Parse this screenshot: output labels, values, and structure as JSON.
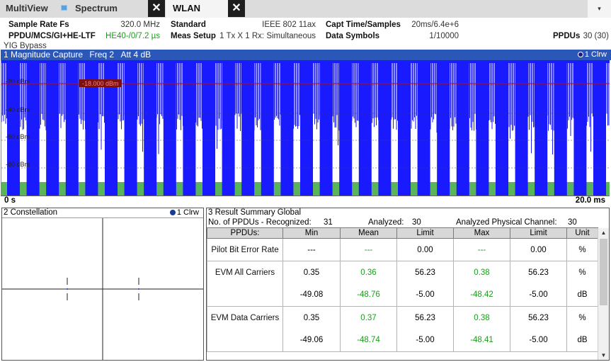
{
  "tabs": {
    "multiview": "MultiView",
    "spectrum": "Spectrum",
    "wlan": "WLAN",
    "close_glyph": "✕",
    "menu_glyph": "▾"
  },
  "header": {
    "sample_rate_label": "Sample Rate Fs",
    "sample_rate_value": "320.0 MHz",
    "standard_label": "Standard",
    "standard_value": "IEEE 802 11ax",
    "capt_label": "Capt Time/Samples",
    "capt_value": "20ms/6.4e+6",
    "ppdu_label": "PPDU/MCS/GI+HE-LTF",
    "ppdu_value": "HE40-/0/7.2 µs",
    "meas_label": "Meas Setup",
    "meas_value": "1 Tx X 1 Rx: Simultaneous",
    "data_symbols_label": "Data Symbols",
    "data_symbols_value": "1/10000",
    "ppdus_label": "PPDUs",
    "ppdus_value": "30 (30)",
    "yig": "YIG Bypass"
  },
  "magnitude": {
    "title": "1 Magnitude Capture",
    "freq": "Freq 2",
    "att": "Att 4 dB",
    "trace": "1 Clrw",
    "trigger_label": "-18.000 dBm",
    "x_start": "0 s",
    "x_end": "20.0 ms",
    "y_ticks": [
      "-20 dBm",
      "-40 dBm",
      "-60 dBm",
      "-80 dBm"
    ],
    "colors": {
      "signal": "#1a1aff",
      "gate": "#5ab45a",
      "trigger": "#cc0000",
      "title_bar": "#2b58b8"
    }
  },
  "constellation": {
    "title": "2 Constellation",
    "trace": "1 Clrw"
  },
  "results": {
    "title": "3 Result Summary Global",
    "recognized_label": "No. of PPDUs - Recognized:",
    "recognized_value": "31",
    "analyzed_label": "Analyzed:",
    "analyzed_value": "30",
    "analyzed_ch_label": "Analyzed Physical Channel:",
    "analyzed_ch_value": "30",
    "columns": [
      "PPDUs:",
      "Min",
      "Mean",
      "Limit",
      "Max",
      "Limit",
      "Unit"
    ],
    "rows": [
      {
        "param": "Pilot Bit Error Rate",
        "min": "---",
        "mean": "---",
        "limit1": "0.00",
        "max": "---",
        "limit2": "0.00",
        "unit": "%"
      },
      {
        "param": "EVM All Carriers",
        "min": "0.35",
        "mean": "0.36",
        "limit1": "56.23",
        "max": "0.38",
        "limit2": "56.23",
        "unit": "%"
      },
      {
        "param": "",
        "min": "-49.08",
        "mean": "-48.76",
        "limit1": "-5.00",
        "max": "-48.42",
        "limit2": "-5.00",
        "unit": "dB"
      },
      {
        "param": "EVM Data Carriers",
        "min": "0.35",
        "mean": "0.37",
        "limit1": "56.23",
        "max": "0.38",
        "limit2": "56.23",
        "unit": "%"
      },
      {
        "param": "",
        "min": "-49.06",
        "mean": "-48.74",
        "limit1": "-5.00",
        "max": "-48.41",
        "limit2": "-5.00",
        "unit": "dB"
      }
    ],
    "scroll_up": "▲",
    "scroll_down": "▼"
  }
}
